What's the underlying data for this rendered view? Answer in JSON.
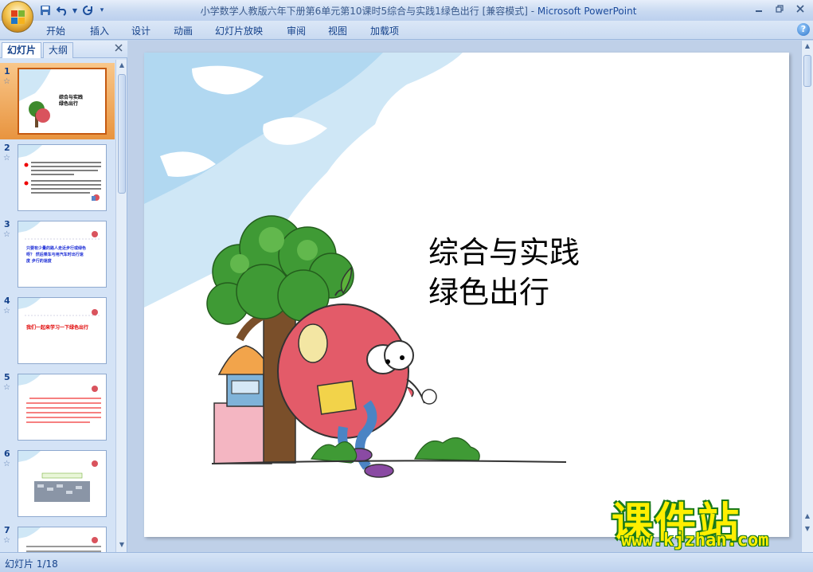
{
  "window": {
    "title": "小学数学人教版六年下册第6单元第10课时5综合与实践1绿色出行 [兼容模式] - ",
    "app_name": "Microsoft PowerPoint"
  },
  "ribbon_tabs": [
    "开始",
    "插入",
    "设计",
    "动画",
    "幻灯片放映",
    "审阅",
    "视图",
    "加载项"
  ],
  "pane_tabs": {
    "slides": "幻灯片",
    "outline": "大纲"
  },
  "thumbnails": [
    {
      "num": "1",
      "lines": [
        "综合与实践",
        "绿色出行"
      ],
      "color": "#000000"
    },
    {
      "num": "2",
      "lines": [],
      "color": "#000000"
    },
    {
      "num": "3",
      "lines": [
        "只要有少量的路人走近步行或绿色",
        "呀？ 然后乘车与用汽车时出行速",
        "度 步行的速度"
      ],
      "color": "#1e2fd6"
    },
    {
      "num": "4",
      "lines": [
        "我们一起来学习一下绿色出行"
      ],
      "color": "#e00000"
    },
    {
      "num": "5",
      "lines": [],
      "color": "#e00000"
    },
    {
      "num": "6",
      "lines": [],
      "color": "#000000"
    },
    {
      "num": "7",
      "lines": [],
      "color": "#000000"
    }
  ],
  "slide": {
    "title_line1": "综合与实践",
    "title_line2": "绿色出行"
  },
  "watermark": {
    "cn": "课件站",
    "url": "www.kjzhan.com"
  },
  "status": {
    "slide_indicator": "幻灯片 1/18"
  },
  "colors": {
    "accent": "#15428b",
    "selected_thumb": "#e8943f",
    "watermark_yellow": "#ffef00",
    "watermark_green": "#1a7a1a"
  }
}
